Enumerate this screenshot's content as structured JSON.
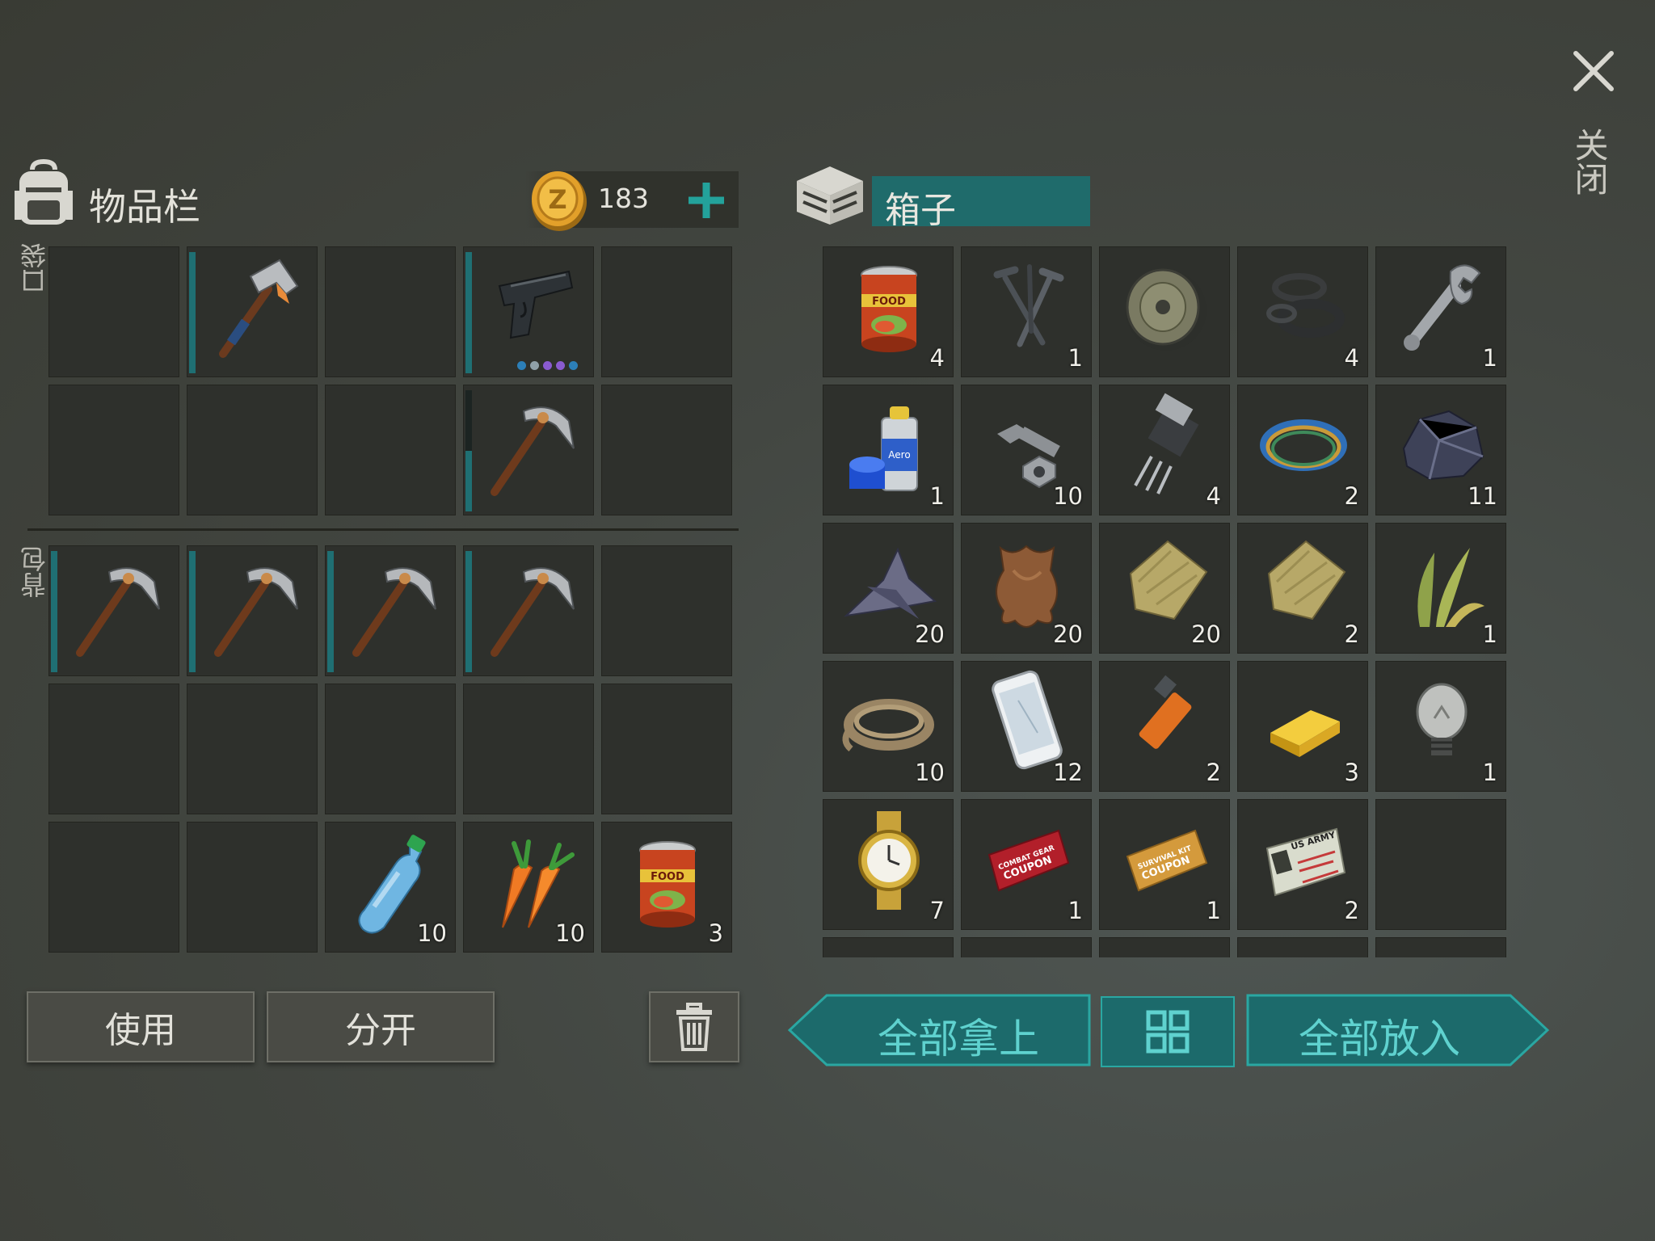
{
  "close": {
    "label": "关闭"
  },
  "inventory": {
    "title": "物品栏",
    "coins": "183",
    "pocket_label": "口袋",
    "backpack_label": "背包",
    "pocket": [
      {
        "icon": "empty"
      },
      {
        "icon": "hammer-icon",
        "bar": "full"
      },
      {
        "icon": "empty"
      },
      {
        "icon": "pistol-icon",
        "bar": "full",
        "dots": [
          "#2c7fb8",
          "#8fa0a8",
          "#8a5bd0",
          "#8a5bd0",
          "#2c7fb8"
        ]
      },
      {
        "icon": "empty"
      },
      {
        "icon": "empty"
      },
      {
        "icon": "empty"
      },
      {
        "icon": "empty"
      },
      {
        "icon": "pickaxe-icon",
        "bar": "partial"
      },
      {
        "icon": "empty"
      }
    ],
    "backpack": [
      {
        "icon": "pickaxe-icon",
        "bar": "full"
      },
      {
        "icon": "pickaxe-icon",
        "bar": "full"
      },
      {
        "icon": "pickaxe-icon",
        "bar": "full"
      },
      {
        "icon": "pickaxe-icon",
        "bar": "full"
      },
      {
        "icon": "empty"
      },
      {
        "icon": "empty"
      },
      {
        "icon": "empty"
      },
      {
        "icon": "empty"
      },
      {
        "icon": "empty"
      },
      {
        "icon": "empty"
      },
      {
        "icon": "empty"
      },
      {
        "icon": "empty"
      },
      {
        "icon": "water-bottle-icon",
        "count": "10"
      },
      {
        "icon": "carrot-icon",
        "count": "10"
      },
      {
        "icon": "canned-food-icon",
        "count": "3"
      }
    ],
    "use_button": "使用",
    "split_button": "分开"
  },
  "box": {
    "title": "箱子",
    "items": [
      {
        "icon": "canned-food-icon",
        "count": "4"
      },
      {
        "icon": "nails-icon",
        "count": "1"
      },
      {
        "icon": "wheel-icon",
        "count": ""
      },
      {
        "icon": "rubber-rings-icon",
        "count": "4"
      },
      {
        "icon": "wrench-icon",
        "count": "1"
      },
      {
        "icon": "spray-paint-icon",
        "count": "1"
      },
      {
        "icon": "bolt-nut-icon",
        "count": "10"
      },
      {
        "icon": "transistor-icon",
        "count": "4"
      },
      {
        "icon": "wire-coil-icon",
        "count": "2"
      },
      {
        "icon": "ore-icon",
        "count": "11"
      },
      {
        "icon": "scrap-metal-icon",
        "count": "20"
      },
      {
        "icon": "leather-hide-icon",
        "count": "20"
      },
      {
        "icon": "cloth-icon",
        "count": "20"
      },
      {
        "icon": "cloth-icon",
        "count": "2"
      },
      {
        "icon": "plant-fiber-icon",
        "count": "1"
      },
      {
        "icon": "rope-icon",
        "count": "10"
      },
      {
        "icon": "smartphone-icon",
        "count": "12"
      },
      {
        "icon": "usb-drive-icon",
        "count": "2"
      },
      {
        "icon": "gold-bar-icon",
        "count": "3"
      },
      {
        "icon": "light-bulb-icon",
        "count": "1"
      },
      {
        "icon": "gold-watch-icon",
        "count": "7"
      },
      {
        "icon": "combat-gear-coupon-icon",
        "count": "1",
        "text1": "COMBAT GEAR",
        "text2": "COUPON"
      },
      {
        "icon": "survival-kit-coupon-icon",
        "count": "1",
        "text1": "SURVIVAL KIT",
        "text2": "COUPON"
      },
      {
        "icon": "army-id-card-icon",
        "count": "2",
        "text1": "US ARMY"
      },
      {
        "icon": "empty",
        "count": ""
      }
    ],
    "take_all_button": "全部拿上",
    "put_all_button": "全部放入"
  },
  "colors": {
    "teal": "#1c6a6b",
    "teal_text": "#5fd2cf",
    "durability_bar": "#1f6f73",
    "slot_bg": "#2e302c"
  }
}
